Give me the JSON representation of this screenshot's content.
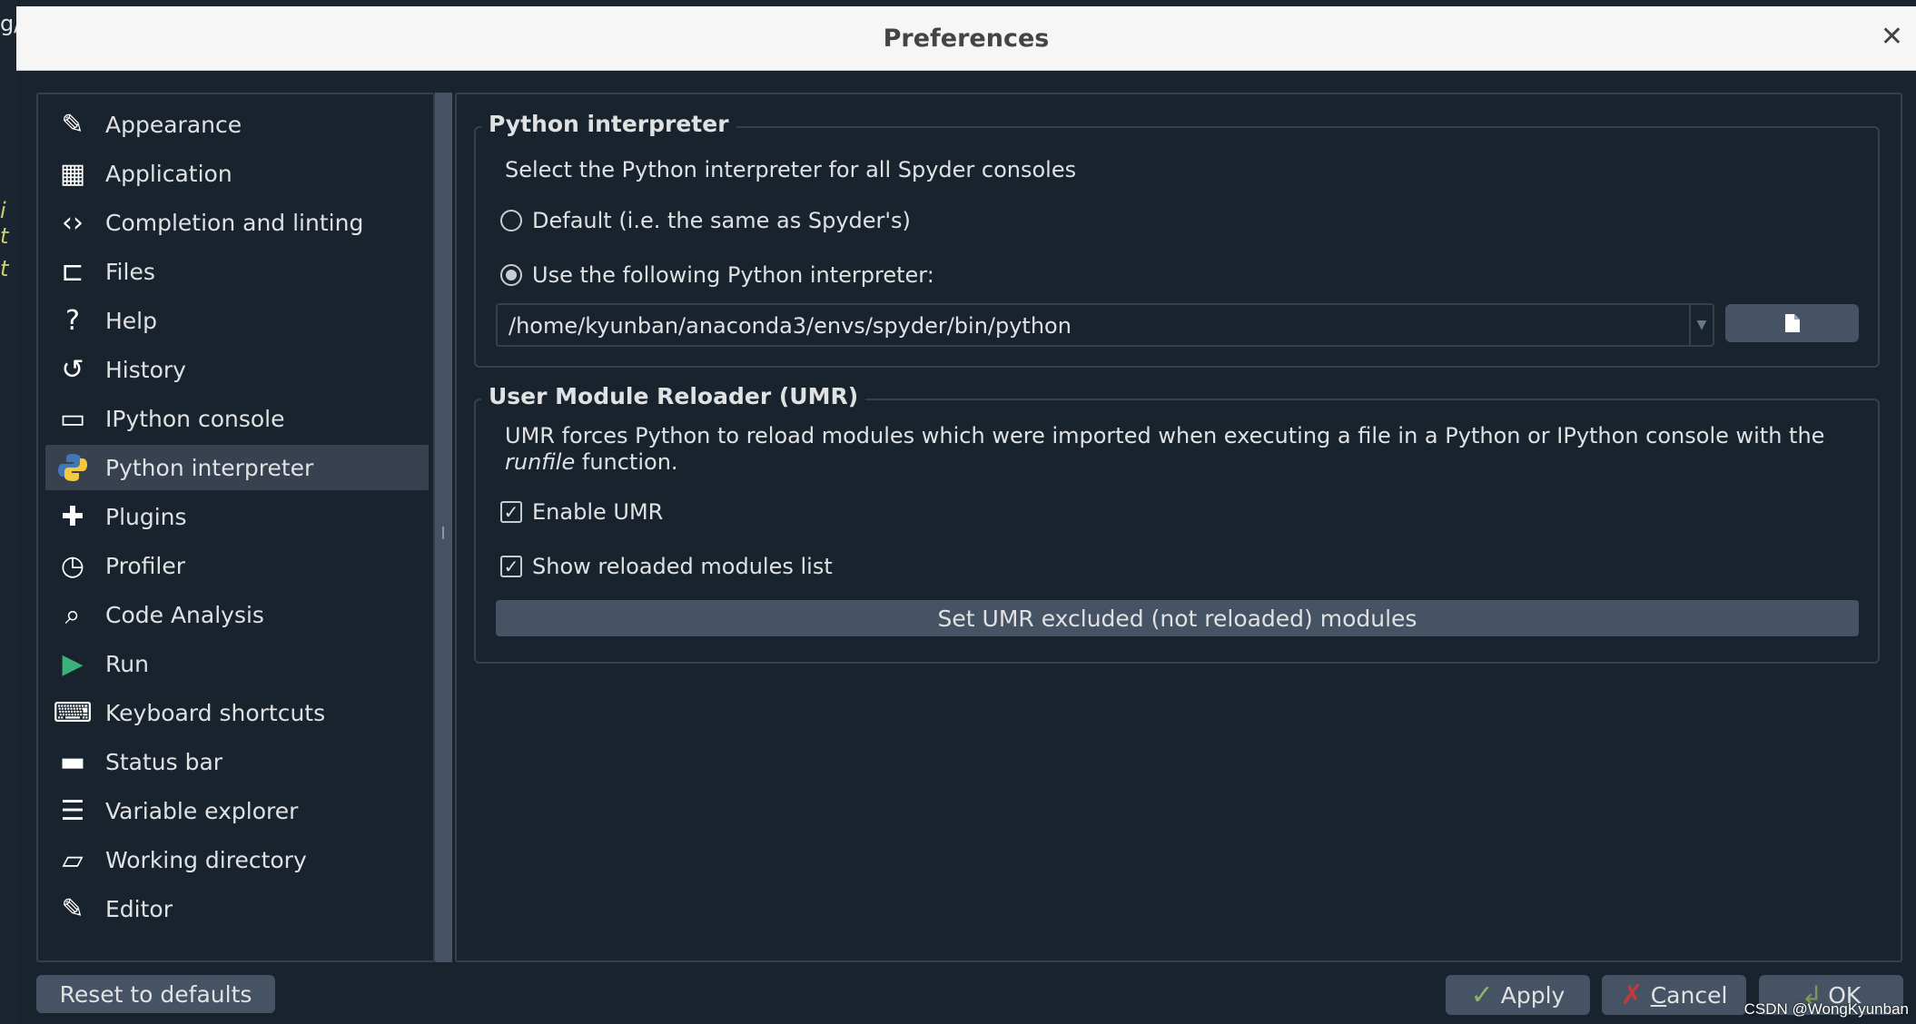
{
  "background": {
    "fragments": [
      "g/",
      "i t",
      "t"
    ]
  },
  "dialog": {
    "title": "Preferences",
    "close_icon": "close-icon"
  },
  "sidebar": {
    "items": [
      {
        "label": "Appearance",
        "icon": "eyedropper-icon"
      },
      {
        "label": "Application",
        "icon": "layout-icon"
      },
      {
        "label": "Completion and linting",
        "icon": "code-check-icon"
      },
      {
        "label": "Files",
        "icon": "file-tree-icon"
      },
      {
        "label": "Help",
        "icon": "help-circle-icon"
      },
      {
        "label": "History",
        "icon": "history-icon"
      },
      {
        "label": "IPython console",
        "icon": "terminal-icon"
      },
      {
        "label": "Python interpreter",
        "icon": "python-icon",
        "selected": true
      },
      {
        "label": "Plugins",
        "icon": "puzzle-icon"
      },
      {
        "label": "Profiler",
        "icon": "stopwatch-icon"
      },
      {
        "label": "Code Analysis",
        "icon": "magnify-check-icon"
      },
      {
        "label": "Run",
        "icon": "play-icon"
      },
      {
        "label": "Keyboard shortcuts",
        "icon": "keyboard-icon"
      },
      {
        "label": "Status bar",
        "icon": "status-bar-icon"
      },
      {
        "label": "Variable explorer",
        "icon": "table-icon"
      },
      {
        "label": "Working directory",
        "icon": "folder-open-icon"
      },
      {
        "label": "Editor",
        "icon": "pencil-icon"
      }
    ]
  },
  "interpreter": {
    "group_title": "Python interpreter",
    "description": "Select the Python interpreter for all Spyder consoles",
    "option_default": "Default (i.e. the same as Spyder's)",
    "option_custom": "Use the following Python interpreter:",
    "selected_option": "custom",
    "path": "/home/kyunban/anaconda3/envs/spyder/bin/python",
    "browse_icon": "file-icon"
  },
  "umr": {
    "group_title": "User Module Reloader (UMR)",
    "description_line1": "UMR forces Python to reload modules which were imported when executing a file in a Python or IPython console with the",
    "description_italic": "runfile",
    "description_line2": " function.",
    "enable_label": "Enable UMR",
    "enable_checked": true,
    "show_label": "Show reloaded modules list",
    "show_checked": true,
    "excluded_button": "Set UMR excluded (not reloaded) modules"
  },
  "footer": {
    "reset": "Reset to defaults",
    "apply": "Apply",
    "cancel_prefix": "C",
    "cancel_rest": "ancel",
    "ok": "OK"
  },
  "watermark": "CSDN @WongKyunban",
  "colors": {
    "background": "#19232d",
    "button": "#455364",
    "selected": "#37414f",
    "border": "#32414b"
  }
}
